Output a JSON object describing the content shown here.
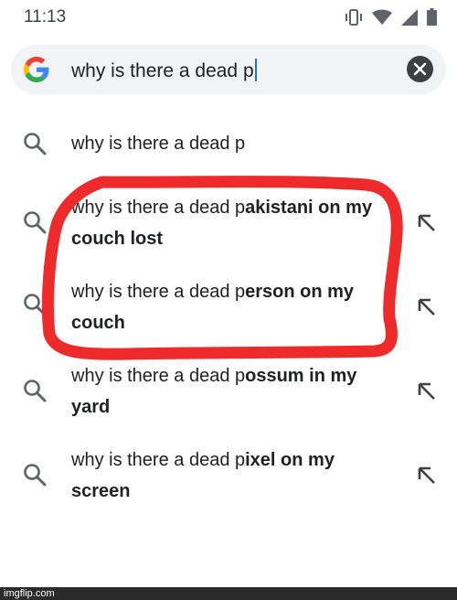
{
  "status_bar": {
    "time": "11:13",
    "icons": [
      "vibrate-icon",
      "wifi-icon",
      "signal-icon",
      "battery-icon"
    ]
  },
  "search": {
    "logo": "google-logo",
    "query": "why is there a dead p",
    "clear_icon": "close-icon"
  },
  "suggestions": [
    {
      "prefix": "why is there a dead p",
      "completion": "",
      "icon": "search-icon",
      "has_arrow": false
    },
    {
      "prefix": "why is there a dead p",
      "completion": "akistani on my couch lost",
      "icon": "search-icon",
      "has_arrow": true
    },
    {
      "prefix": "why is there a dead p",
      "completion": "erson on my couch",
      "icon": "search-icon",
      "has_arrow": true
    },
    {
      "prefix": "why is there a dead p",
      "completion": "ossum in my yard",
      "icon": "search-icon",
      "has_arrow": true
    },
    {
      "prefix": "why is there a dead p",
      "completion": "ixel on my screen",
      "icon": "search-icon",
      "has_arrow": true
    }
  ],
  "colors": {
    "annotation": "#ee2a2a",
    "search_bg": "#f1f3f4",
    "caret": "#1a73e8"
  },
  "watermark": "imgflip.com"
}
